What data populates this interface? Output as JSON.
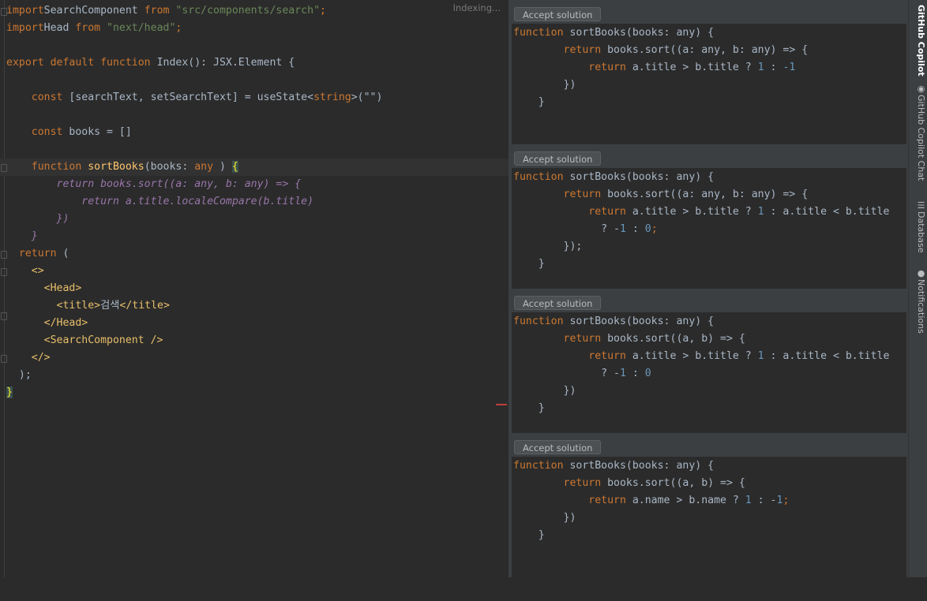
{
  "editor": {
    "status": "Indexing...",
    "lines": [
      [
        [
          "kw",
          "import"
        ],
        [
          "",
          "SearchComponent "
        ],
        [
          "kw",
          "from"
        ],
        [
          "str",
          " \"src/components/search\""
        ],
        [
          "kw",
          ";"
        ]
      ],
      [
        [
          "kw",
          "import"
        ],
        [
          "",
          "Head "
        ],
        [
          "kw",
          "from"
        ],
        [
          "str",
          " \"next/head\""
        ],
        [
          "kw",
          ";"
        ]
      ],
      [],
      [
        [
          "kw",
          "export default function "
        ],
        [
          "",
          "Index(): JSX.Element {"
        ]
      ],
      [],
      [
        [
          "",
          "    "
        ],
        [
          "kw",
          "const "
        ],
        [
          "",
          "[searchText, setSearchText] = useState<"
        ],
        [
          "kw",
          "string"
        ],
        [
          "",
          ">(\"\")"
        ]
      ],
      [],
      [
        [
          "",
          "    "
        ],
        [
          "kw",
          "const "
        ],
        [
          "",
          "books = []"
        ]
      ],
      [],
      [
        [
          "",
          "    "
        ],
        [
          "kw",
          "function "
        ],
        [
          "fn",
          "sortBooks"
        ],
        [
          "",
          "(books: "
        ],
        [
          "kw",
          "any"
        ],
        [
          "",
          " ) "
        ],
        [
          "brace-hl",
          "{"
        ]
      ],
      [
        [
          "",
          "        "
        ],
        [
          "ital",
          "return books.sort((a: any, b: any) => {"
        ]
      ],
      [
        [
          "",
          "            "
        ],
        [
          "ital",
          "return a.title.localeCompare(b.title)"
        ]
      ],
      [
        [
          "",
          "        "
        ],
        [
          "ital",
          "})"
        ]
      ],
      [
        [
          "",
          "    "
        ],
        [
          "ital",
          "}"
        ]
      ],
      [
        [
          "",
          "  "
        ],
        [
          "kw",
          "return "
        ],
        [
          "",
          "("
        ]
      ],
      [
        [
          "",
          "    "
        ],
        [
          "tag",
          "<>"
        ]
      ],
      [
        [
          "",
          "      "
        ],
        [
          "tag",
          "<Head>"
        ]
      ],
      [
        [
          "",
          "        "
        ],
        [
          "tag",
          "<title>"
        ],
        [
          "",
          "검색"
        ],
        [
          "tag",
          "</title>"
        ]
      ],
      [
        [
          "",
          "      "
        ],
        [
          "tag",
          "</Head>"
        ]
      ],
      [
        [
          "",
          "      "
        ],
        [
          "tag",
          "<SearchComponent />"
        ]
      ],
      [
        [
          "",
          "    "
        ],
        [
          "tag",
          "</>"
        ]
      ],
      [
        [
          "",
          "  );"
        ]
      ],
      [
        [
          "brace-hl",
          "}"
        ]
      ]
    ]
  },
  "copilot": {
    "accept_label": "Accept solution",
    "solutions": [
      {
        "lines": [
          [
            [
              "kw",
              "function "
            ],
            [
              "",
              "sortBooks(books: any) {"
            ]
          ],
          [
            [
              "",
              "        "
            ],
            [
              "kw",
              "return "
            ],
            [
              "",
              "books.sort((a: any, b: any) => {"
            ]
          ],
          [
            [
              "",
              "            "
            ],
            [
              "kw",
              "return "
            ],
            [
              "",
              "a.title > b.title ? "
            ],
            [
              "num",
              "1"
            ],
            [
              "",
              " : "
            ],
            [
              "num",
              "-1"
            ]
          ],
          [
            [
              "",
              "        })"
            ]
          ],
          [
            [
              "",
              "    }"
            ]
          ]
        ]
      },
      {
        "lines": [
          [
            [
              "kw",
              "function "
            ],
            [
              "",
              "sortBooks(books: any) {"
            ]
          ],
          [
            [
              "",
              "        "
            ],
            [
              "kw",
              "return "
            ],
            [
              "",
              "books.sort((a: any, b: any) => {"
            ]
          ],
          [
            [
              "",
              "            "
            ],
            [
              "kw",
              "return "
            ],
            [
              "",
              "a.title > b.title ? "
            ],
            [
              "num",
              "1"
            ],
            [
              "",
              " : a.title < b.title"
            ]
          ],
          [
            [
              "",
              "              ? -"
            ],
            [
              "num",
              "1"
            ],
            [
              "",
              " : "
            ],
            [
              "num",
              "0"
            ],
            [
              "kw",
              ";"
            ]
          ],
          [
            [
              "",
              "        });"
            ]
          ],
          [
            [
              "",
              "    }"
            ]
          ]
        ]
      },
      {
        "lines": [
          [
            [
              "kw",
              "function "
            ],
            [
              "",
              "sortBooks(books: any) {"
            ]
          ],
          [
            [
              "",
              "        "
            ],
            [
              "kw",
              "return "
            ],
            [
              "",
              "books.sort((a, b) => {"
            ]
          ],
          [
            [
              "",
              "            "
            ],
            [
              "kw",
              "return "
            ],
            [
              "",
              "a.title > b.title ? "
            ],
            [
              "num",
              "1"
            ],
            [
              "",
              " : a.title < b.title"
            ]
          ],
          [
            [
              "",
              "              ? -"
            ],
            [
              "num",
              "1"
            ],
            [
              "",
              " : "
            ],
            [
              "num",
              "0"
            ]
          ],
          [
            [
              "",
              "        })"
            ]
          ],
          [
            [
              "",
              "    }"
            ]
          ]
        ]
      },
      {
        "lines": [
          [
            [
              "kw",
              "function "
            ],
            [
              "",
              "sortBooks(books: any) {"
            ]
          ],
          [
            [
              "",
              "        "
            ],
            [
              "kw",
              "return "
            ],
            [
              "",
              "books.sort((a, b) => {"
            ]
          ],
          [
            [
              "",
              "            "
            ],
            [
              "kw",
              "return "
            ],
            [
              "",
              "a.name > b.name ? "
            ],
            [
              "num",
              "1"
            ],
            [
              "",
              " : -"
            ],
            [
              "num",
              "1"
            ],
            [
              "kw",
              ";"
            ]
          ],
          [
            [
              "",
              "        })"
            ]
          ],
          [
            [
              "",
              "    }"
            ]
          ]
        ]
      }
    ]
  },
  "toolwindows": [
    {
      "label": "GitHub Copilot",
      "icon": "none"
    },
    {
      "label": "GitHub Copilot Chat",
      "icon": "copilot-chat-icon"
    },
    {
      "label": "Database",
      "icon": "database-icon"
    },
    {
      "label": "Notifications",
      "icon": "bell-icon"
    }
  ],
  "colors": {
    "background": "#2b2b2b",
    "panel": "#3c3f41",
    "keyword": "#cc7832",
    "string": "#6a8759",
    "function": "#ffc66d",
    "tag": "#e8bf6a",
    "number": "#6897bb"
  }
}
